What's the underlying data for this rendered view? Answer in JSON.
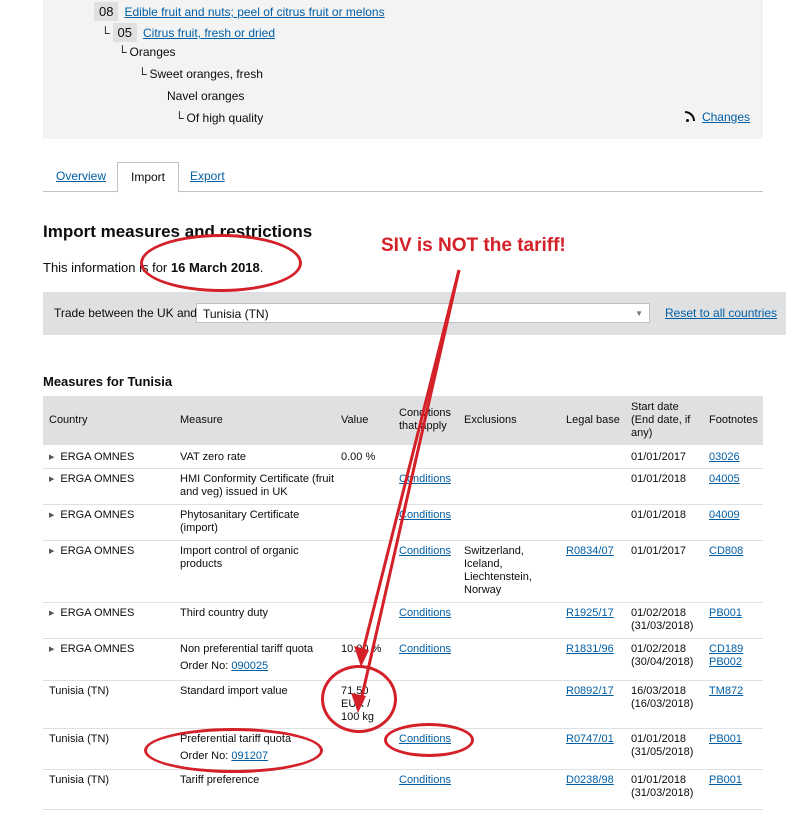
{
  "tree": {
    "chapter_code": "08",
    "chapter_label": "Edible fruit and nuts; peel of citrus fruit or melons",
    "heading_code": "05",
    "heading_label": "Citrus fruit, fresh or dried",
    "level1": "Oranges",
    "level2": "Sweet oranges, fresh",
    "level3": "Navel oranges",
    "level4": "Of high quality",
    "changes_label": "Changes"
  },
  "tabs": [
    "Overview",
    "Import",
    "Export"
  ],
  "active_tab": "Import",
  "section_title": "Import measures and restrictions",
  "info_prefix": "This information is for ",
  "info_date": "16 March 2018",
  "info_suffix": ".",
  "filter": {
    "label": "Trade between the UK and",
    "selected_country": "Tunisia (TN)",
    "reset_label": "Reset to all countries"
  },
  "measures_title": "Measures for Tunisia",
  "table": {
    "headers": [
      "Country",
      "Measure",
      "Value",
      "Conditions that apply",
      "Exclusions",
      "Legal base",
      "Start date (End date, if any)",
      "Footnotes"
    ],
    "rows": [
      {
        "country": "ERGA OMNES",
        "expandable": true,
        "measure": "VAT zero rate",
        "value": "0.00 %",
        "conditions": "",
        "exclusions": "",
        "legal": "",
        "start": "01/01/2017",
        "footnotes": [
          "03026"
        ]
      },
      {
        "country": "ERGA OMNES",
        "expandable": true,
        "measure": "HMI Conformity Certificate (fruit and veg) issued in UK",
        "value": "",
        "conditions": "Conditions",
        "exclusions": "",
        "legal": "",
        "start": "01/01/2018",
        "footnotes": [
          "04005"
        ]
      },
      {
        "country": "ERGA OMNES",
        "expandable": true,
        "measure": "Phytosanitary Certificate (import)",
        "value": "",
        "conditions": "Conditions",
        "exclusions": "",
        "legal": "",
        "start": "01/01/2018",
        "footnotes": [
          "04009"
        ]
      },
      {
        "country": "ERGA OMNES",
        "expandable": true,
        "measure": "Import control of organic products",
        "value": "",
        "conditions": "Conditions",
        "exclusions": "Switzerland, Iceland, Liechtenstein, Norway",
        "legal": "R0834/07",
        "start": "01/01/2017",
        "footnotes": [
          "CD808"
        ]
      },
      {
        "country": "ERGA OMNES",
        "expandable": true,
        "measure": "Third country duty",
        "value": "",
        "conditions": "Conditions",
        "exclusions": "",
        "legal": "R1925/17",
        "start": "01/02/2018 (31/03/2018)",
        "footnotes": [
          "PB001"
        ]
      },
      {
        "country": "ERGA OMNES",
        "expandable": true,
        "measure": "Non preferential tariff quota",
        "order_prefix": "Order No: ",
        "order_no": "090025",
        "value": "10.00 %",
        "conditions": "Conditions",
        "exclusions": "",
        "legal": "R1831/96",
        "start": "01/02/2018 (30/04/2018)",
        "footnotes": [
          "CD189",
          "PB002"
        ]
      },
      {
        "country": "Tunisia (TN)",
        "expandable": false,
        "measure": "Standard import value",
        "value": "71.50 EUR / 100 kg",
        "conditions": "",
        "exclusions": "",
        "legal": "R0892/17",
        "start": "16/03/2018 (16/03/2018)",
        "footnotes": [
          "TM872"
        ]
      },
      {
        "country": "Tunisia (TN)",
        "expandable": false,
        "measure": "Preferential tariff quota",
        "order_prefix": "Order No: ",
        "order_no": "091207",
        "value": "",
        "conditions": "Conditions",
        "exclusions": "",
        "legal": "R0747/01",
        "start": "01/01/2018 (31/05/2018)",
        "footnotes": [
          "PB001"
        ]
      },
      {
        "country": "Tunisia (TN)",
        "expandable": false,
        "measure": "Tariff preference",
        "value": "",
        "conditions": "Conditions",
        "exclusions": "",
        "legal": "D0238/98",
        "start": "01/01/2018 (31/03/2018)",
        "footnotes": [
          "PB001"
        ]
      }
    ]
  },
  "annotation": {
    "text": "SIV is NOT the tariff!",
    "color": "#d42028"
  }
}
